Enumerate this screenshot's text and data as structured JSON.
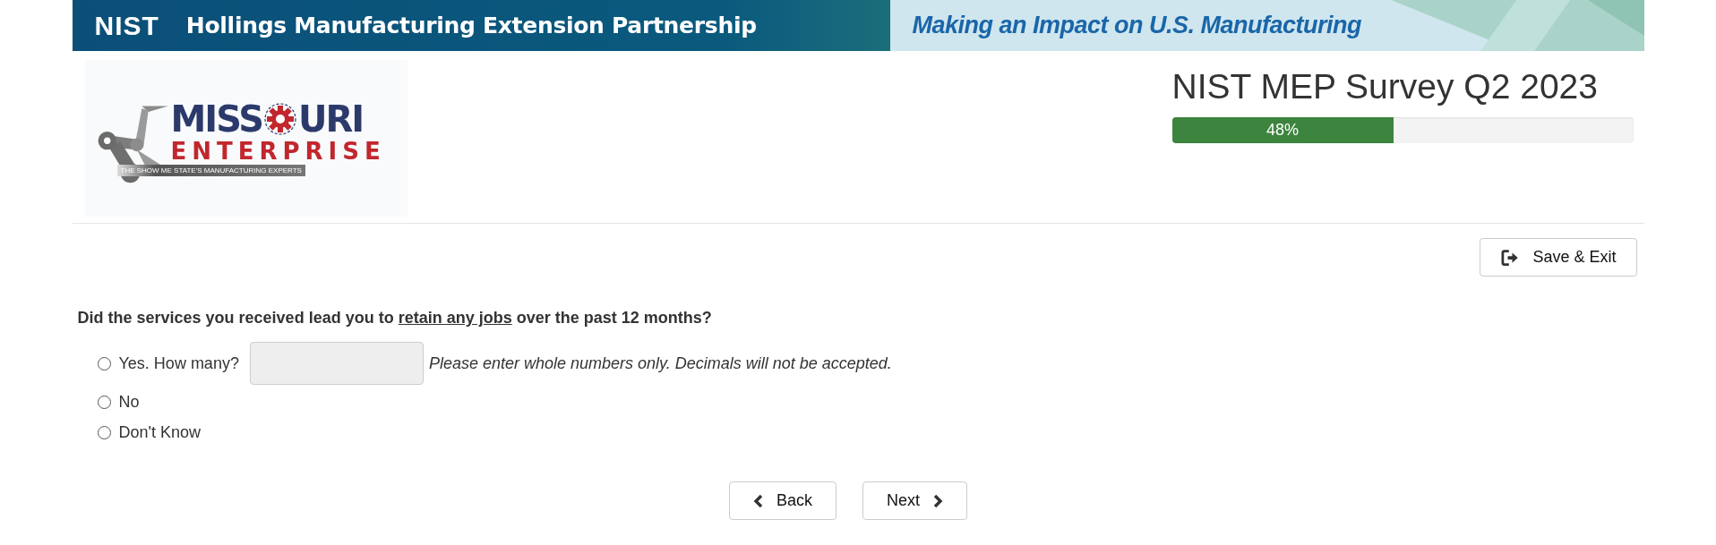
{
  "banner": {
    "agency": "NIST",
    "program": "Hollings Manufacturing Extension Partnership",
    "slogan": "Making an Impact on U.S. Manufacturing"
  },
  "logo": {
    "word_left": "MISS",
    "word_right": "URI",
    "subtitle": "ENTERPRISE",
    "tagline": "THE SHOW ME STATE'S MANUFACTURING EXPERTS"
  },
  "survey": {
    "title": "NIST MEP Survey Q2 2023",
    "progress": {
      "level": 0.48,
      "label": "48%"
    }
  },
  "save_button": "Save & Exit",
  "question": {
    "before": "Did the services you received lead you to ",
    "underlined": "retain any jobs",
    "after": " over the past 12 months?"
  },
  "options": [
    {
      "kind": "number",
      "label": "Yes. How many?",
      "selected": false,
      "hint": "Please enter whole numbers only. Decimals will not be accepted."
    },
    {
      "kind": "plain",
      "label": "No",
      "selected": false
    },
    {
      "kind": "plain",
      "label": "Don't Know",
      "selected": false
    }
  ],
  "nav": [
    {
      "kind": "back",
      "label": "Back"
    },
    {
      "kind": "next",
      "label": "Next"
    }
  ]
}
